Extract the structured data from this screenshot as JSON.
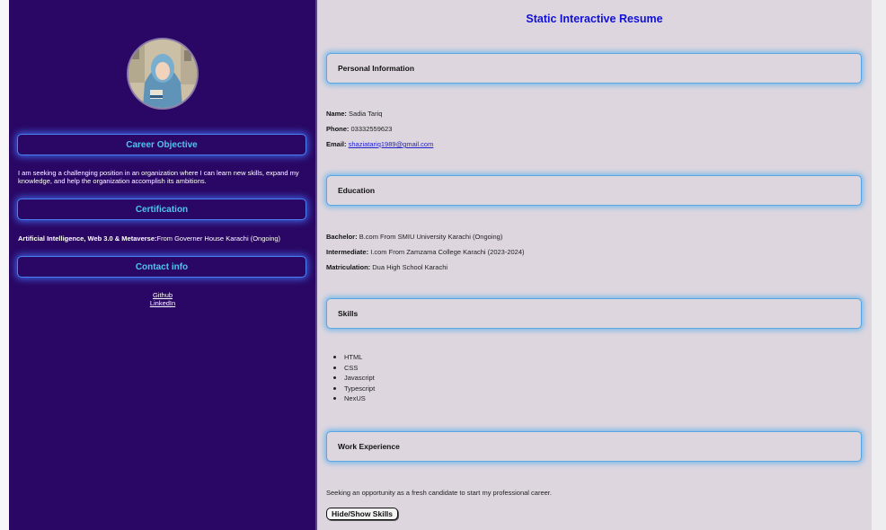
{
  "colors": {
    "sidebar_bg": "#2a0764",
    "sidebar_heading": "#4fc4f0",
    "sidebar_box_glow": "#4078ff",
    "main_bg": "#ddd6df",
    "title": "#1010d8",
    "section_glow": "#5aafeb",
    "link": "#2222cc"
  },
  "sidebar": {
    "avatar_icon": "profile-photo",
    "career_objective": {
      "heading": "Career Objective",
      "text": "I am seeking a challenging position in an organization where I can learn new skills, expand my knowledge, and help the organization accomplish its ambitions."
    },
    "certification": {
      "heading": "Certification",
      "name": "Artificial Intelligence, Web 3.0 & Metaverse:",
      "detail": "From Governer House Karachi (Ongoing)"
    },
    "contact": {
      "heading": "Contact info",
      "links": [
        "Github",
        "LinkedIn"
      ]
    }
  },
  "main": {
    "title": "Static Interactive Resume",
    "personal": {
      "heading": "Personal Information",
      "name_label": "Name:",
      "name_value": "Sadia Tariq",
      "phone_label": "Phone:",
      "phone_value": "03332559623",
      "email_label": "Email:",
      "email_value": "shaziatariq1989@gmail.com"
    },
    "education": {
      "heading": "Education",
      "items": [
        {
          "label": "Bachelor:",
          "value": "B.com From SMIU University Karachi (Ongoing)"
        },
        {
          "label": "Intermediate:",
          "value": "I.com From Zamzama College Karachi (2023-2024)"
        },
        {
          "label": "Matriculation:",
          "value": "Dua High School Karachi"
        }
      ]
    },
    "skills": {
      "heading": "Skills",
      "items": [
        "HTML",
        "CSS",
        "Javascript",
        "Typescript",
        "NexUS"
      ]
    },
    "work": {
      "heading": "Work Experience",
      "text": "Seeking an opportunity as a fresh candidate to start my professional career."
    },
    "toggle_button": "Hide/Show Skills"
  }
}
